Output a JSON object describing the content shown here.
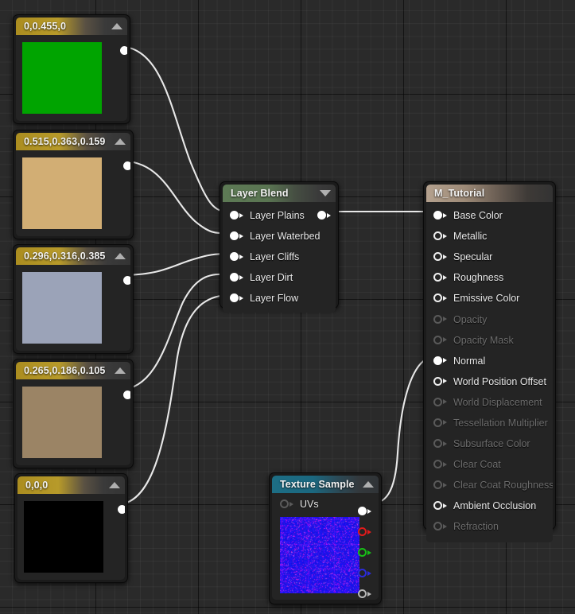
{
  "editor": {
    "name": "unreal-material-graph",
    "background": "#2a2a2a"
  },
  "nodes": {
    "const_plains": {
      "title": "0,0.455,0",
      "color": "#00a400",
      "collapse_icon": "triangle-up-icon",
      "output_pin": "output-pin"
    },
    "const_waterbed": {
      "title": "0.515,0.363,0.159",
      "color": "#d2ae74",
      "collapse_icon": "triangle-up-icon",
      "output_pin": "output-pin"
    },
    "const_cliffs": {
      "title": "0.296,0.316,0.385",
      "color": "#9ba3b8",
      "collapse_icon": "triangle-up-icon",
      "output_pin": "output-pin"
    },
    "const_dirt": {
      "title": "0.265,0.186,0.105",
      "color": "#9b8465",
      "collapse_icon": "triangle-up-icon",
      "output_pin": "output-pin"
    },
    "const_flow": {
      "title": "0,0,0",
      "color": "#000000",
      "collapse_icon": "triangle-up-icon",
      "output_pin": "output-pin"
    },
    "layer_blend": {
      "title": "Layer Blend",
      "collapse_icon": "triangle-down-icon",
      "inputs": [
        {
          "label": "Layer Plains",
          "state": "connected"
        },
        {
          "label": "Layer Waterbed",
          "state": "connected"
        },
        {
          "label": "Layer Cliffs",
          "state": "connected"
        },
        {
          "label": "Layer Dirt",
          "state": "connected"
        },
        {
          "label": "Layer Flow",
          "state": "connected"
        }
      ],
      "outputs": [
        {
          "label": "",
          "state": "connected"
        }
      ]
    },
    "material": {
      "title": "M_Tutorial",
      "inputs": [
        {
          "label": "Base Color",
          "state": "connected"
        },
        {
          "label": "Metallic",
          "state": "enabled"
        },
        {
          "label": "Specular",
          "state": "enabled"
        },
        {
          "label": "Roughness",
          "state": "enabled"
        },
        {
          "label": "Emissive Color",
          "state": "enabled"
        },
        {
          "label": "Opacity",
          "state": "disabled"
        },
        {
          "label": "Opacity Mask",
          "state": "disabled"
        },
        {
          "label": "Normal",
          "state": "connected"
        },
        {
          "label": "World Position Offset",
          "state": "enabled"
        },
        {
          "label": "World Displacement",
          "state": "disabled"
        },
        {
          "label": "Tessellation Multiplier",
          "state": "disabled"
        },
        {
          "label": "Subsurface Color",
          "state": "disabled"
        },
        {
          "label": "Clear Coat",
          "state": "disabled"
        },
        {
          "label": "Clear Coat Roughness",
          "state": "disabled"
        },
        {
          "label": "Ambient Occlusion",
          "state": "enabled"
        },
        {
          "label": "Refraction",
          "state": "disabled"
        }
      ]
    },
    "texture_sample": {
      "title": "Texture Sample",
      "collapse_icon": "triangle-up-icon",
      "inputs": [
        {
          "label": "UVs",
          "state": "disabled"
        }
      ],
      "outputs": [
        {
          "label": "RGB",
          "channel": "rgb",
          "color": "#ffffff",
          "state": "connected"
        },
        {
          "label": "R",
          "channel": "red",
          "color": "#e01b1b",
          "state": "enabled"
        },
        {
          "label": "G",
          "channel": "green",
          "color": "#17c017",
          "state": "enabled"
        },
        {
          "label": "B",
          "channel": "blue",
          "color": "#2b2bdc",
          "state": "enabled"
        },
        {
          "label": "A",
          "channel": "alpha",
          "color": "#b9b9b9",
          "state": "enabled"
        }
      ],
      "preview_color": "#1a16ff"
    }
  },
  "wires": {
    "color": "#e8e8e8",
    "connections": [
      "const_plains.out -> layer_blend.Layer Plains",
      "const_waterbed.out -> layer_blend.Layer Waterbed",
      "const_cliffs.out -> layer_blend.Layer Cliffs",
      "const_dirt.out -> layer_blend.Layer Dirt",
      "const_flow.out -> layer_blend.Layer Flow",
      "layer_blend.out -> material.Base Color",
      "texture_sample.RGB -> material.Normal"
    ]
  }
}
